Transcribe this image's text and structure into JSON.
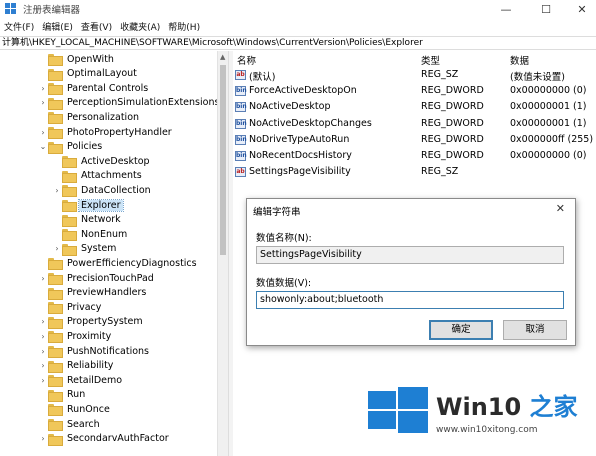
{
  "titlebar": {
    "title": "注册表编辑器",
    "min": "—",
    "max": "☐",
    "close": "✕"
  },
  "menu": [
    "文件(F)",
    "编辑(E)",
    "查看(V)",
    "收藏夹(A)",
    "帮助(H)"
  ],
  "address": "计算机\\HKEY_LOCAL_MACHINE\\SOFTWARE\\Microsoft\\Windows\\CurrentVersion\\Policies\\Explorer",
  "tree": [
    {
      "label": "OpenWith",
      "expander": "",
      "indent": 0
    },
    {
      "label": "OptimalLayout",
      "expander": "",
      "indent": 0
    },
    {
      "label": "Parental Controls",
      "expander": "›",
      "indent": 0
    },
    {
      "label": "PerceptionSimulationExtensions",
      "expander": "›",
      "indent": 0
    },
    {
      "label": "Personalization",
      "expander": "",
      "indent": 0
    },
    {
      "label": "PhotoPropertyHandler",
      "expander": "›",
      "indent": 0
    },
    {
      "label": "Policies",
      "expander": "⌄",
      "indent": 0
    },
    {
      "label": "ActiveDesktop",
      "expander": "",
      "indent": 1
    },
    {
      "label": "Attachments",
      "expander": "",
      "indent": 1
    },
    {
      "label": "DataCollection",
      "expander": "›",
      "indent": 1
    },
    {
      "label": "Explorer",
      "expander": "",
      "indent": 1,
      "selected": true
    },
    {
      "label": "Network",
      "expander": "",
      "indent": 1
    },
    {
      "label": "NonEnum",
      "expander": "",
      "indent": 1
    },
    {
      "label": "System",
      "expander": "›",
      "indent": 1
    },
    {
      "label": "PowerEfficiencyDiagnostics",
      "expander": "",
      "indent": 0
    },
    {
      "label": "PrecisionTouchPad",
      "expander": "›",
      "indent": 0
    },
    {
      "label": "PreviewHandlers",
      "expander": "",
      "indent": 0
    },
    {
      "label": "Privacy",
      "expander": "",
      "indent": 0
    },
    {
      "label": "PropertySystem",
      "expander": "›",
      "indent": 0
    },
    {
      "label": "Proximity",
      "expander": "›",
      "indent": 0
    },
    {
      "label": "PushNotifications",
      "expander": "›",
      "indent": 0
    },
    {
      "label": "Reliability",
      "expander": "›",
      "indent": 0
    },
    {
      "label": "RetailDemo",
      "expander": "›",
      "indent": 0
    },
    {
      "label": "Run",
      "expander": "",
      "indent": 0
    },
    {
      "label": "RunOnce",
      "expander": "",
      "indent": 0
    },
    {
      "label": "Search",
      "expander": "",
      "indent": 0
    },
    {
      "label": "SecondarvAuthFactor",
      "expander": "›",
      "indent": 0
    }
  ],
  "list_header": {
    "name": "名称",
    "type": "类型",
    "data": "数据"
  },
  "values": [
    {
      "name": "(默认)",
      "type": "REG_SZ",
      "data": "(数值未设置)",
      "icon": "ab"
    },
    {
      "name": "ForceActiveDesktopOn",
      "type": "REG_DWORD",
      "data": "0x00000000 (0)",
      "icon": "bin"
    },
    {
      "name": "NoActiveDesktop",
      "type": "REG_DWORD",
      "data": "0x00000001 (1)",
      "icon": "bin"
    },
    {
      "name": "NoActiveDesktopChanges",
      "type": "REG_DWORD",
      "data": "0x00000001 (1)",
      "icon": "bin"
    },
    {
      "name": "NoDriveTypeAutoRun",
      "type": "REG_DWORD",
      "data": "0x000000ff (255)",
      "icon": "bin"
    },
    {
      "name": "NoRecentDocsHistory",
      "type": "REG_DWORD",
      "data": "0x00000000 (0)",
      "icon": "bin"
    },
    {
      "name": "SettingsPageVisibility",
      "type": "REG_SZ",
      "data": "",
      "icon": "ab"
    }
  ],
  "dialog": {
    "title": "编辑字符串",
    "close": "✕",
    "name_label": "数值名称(N):",
    "name_value": "SettingsPageVisibility",
    "data_label": "数值数据(V):",
    "data_value": "showonly:about;bluetooth",
    "ok": "确定",
    "cancel": "取消"
  },
  "watermark": {
    "brand": "Win10",
    "brand_zh": "之家",
    "url": "www.win10xitong.com"
  },
  "colors": {
    "accent": "#1e7fd3",
    "folder": "#f0c75a",
    "selection": "#cce4f7"
  }
}
